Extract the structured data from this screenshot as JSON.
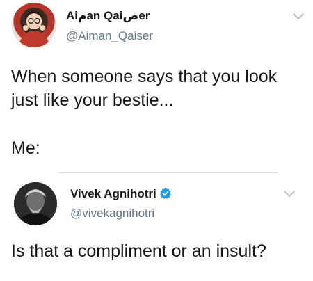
{
  "outer_tweet": {
    "display_name": "Aiمan Qaiصer",
    "handle": "@Aiman_Qaiser",
    "text_line1": "When someone says that you look",
    "text_line2": "just like your bestie...",
    "text_line3": "Me:",
    "avatar_icon": "profile-photo-woman",
    "menu_icon": "chevron-down-icon"
  },
  "inner_tweet": {
    "display_name": "Vivek Agnihotri",
    "verified": true,
    "handle": "@vivekagnihotri",
    "text": "Is that a compliment or an insult?",
    "avatar_icon": "profile-photo-man",
    "menu_icon": "chevron-down-icon"
  },
  "colors": {
    "text": "#14171a",
    "handle": "#657786",
    "verified_badge": "#1da1f2",
    "divider": "#d8dde1",
    "chevron": "#aab8c2"
  }
}
